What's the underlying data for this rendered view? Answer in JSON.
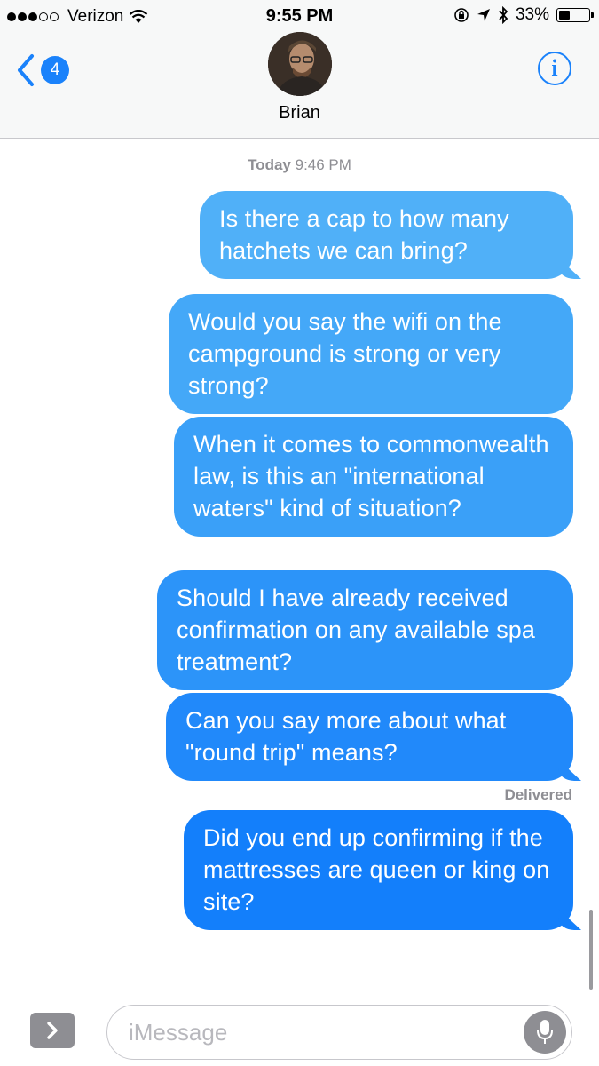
{
  "status_bar": {
    "carrier": "Verizon",
    "time": "9:55 PM",
    "battery_percent": "33%",
    "battery_level": 0.33,
    "icons": [
      "wifi-icon",
      "orientation-lock-icon",
      "location-icon",
      "bluetooth-icon",
      "battery-icon"
    ]
  },
  "nav": {
    "back_badge": "4",
    "contact_name": "Brian",
    "info_label": "i"
  },
  "thread": {
    "timestamp_day": "Today",
    "timestamp_time": "9:46 PM",
    "messages": [
      {
        "text": "Is there a cap to how many hatchets we can bring?",
        "color": "#50b0f8"
      },
      {
        "text": "Would you say the wifi on the campground is strong or very strong?",
        "color": "#44a8f8"
      },
      {
        "text": "When it comes to commonwealth law, is this an \"international waters\" kind of situation?",
        "color": "#3aa0f8"
      },
      {
        "text": "Should I have already received confirmation on any available spa treatment?",
        "color": "#2c94f9"
      },
      {
        "text": "Can you say more about what \"round trip\" means?",
        "color": "#2189fa"
      },
      {
        "text": "Did you end up confirming if the mattresses are queen or king on site?",
        "color": "#137ffb"
      }
    ],
    "delivered_label": "Delivered"
  },
  "input_bar": {
    "placeholder": "iMessage",
    "value": "",
    "apps_label": ">"
  },
  "colors": {
    "accent": "#1a82fb",
    "secondary_text": "#8e8e93",
    "header_bg": "#f7f8f8"
  }
}
